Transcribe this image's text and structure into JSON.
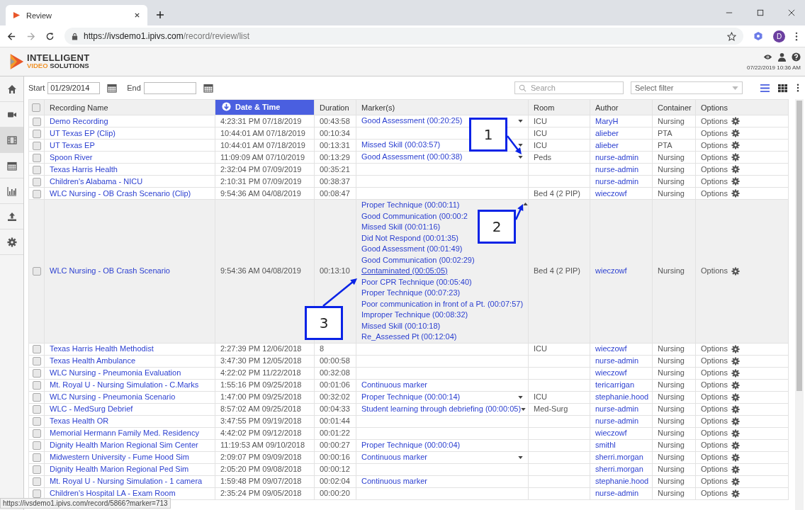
{
  "browser": {
    "tab_title": "Review",
    "url_host": "https://ivsdemo1.ipivs.com",
    "url_path": "/record/review/list",
    "profile_initial": "D"
  },
  "app": {
    "brand_line1": "INTELLIGENT",
    "brand_accent": "VIDEO",
    "brand_rest": "SOLUTIONS",
    "datetime": "07/22/2019 10:36 AM"
  },
  "sidebar": {
    "items": [
      {
        "kind": "home",
        "selected": false
      },
      {
        "kind": "camera",
        "selected": false
      },
      {
        "kind": "film",
        "selected": true
      },
      {
        "kind": "calendar",
        "selected": false
      },
      {
        "kind": "chart",
        "selected": false
      },
      {
        "kind": "upload",
        "selected": false
      },
      {
        "kind": "settings",
        "selected": false
      }
    ]
  },
  "filters": {
    "start_label": "Start",
    "start_value": "01/29/2014",
    "end_label": "End"
  },
  "search": {
    "placeholder": "Search"
  },
  "filter_select": {
    "placeholder": "Select filter"
  },
  "view_modes": [
    {
      "kind": "list",
      "selected": true
    },
    {
      "kind": "grid",
      "selected": false
    }
  ],
  "table": {
    "select_all_checked": false,
    "columns": [
      {
        "label": "Recording Name",
        "selected": false
      },
      {
        "label": "Date & Time",
        "selected": true
      },
      {
        "label": "Duration",
        "selected": false
      },
      {
        "label": "Marker(s)",
        "selected": false
      },
      {
        "label": "Room",
        "selected": false
      },
      {
        "label": "Author",
        "selected": false
      },
      {
        "label": "Container",
        "selected": false
      },
      {
        "label": "Options",
        "selected": false
      }
    ],
    "rows": [
      {
        "checked": false,
        "hovered": false,
        "name": "Demo Recording",
        "date_time": "4:23:31 PM 07/18/2019",
        "duration": "00:43:58",
        "markers": [
          {
            "label": "Good Assessment (00:20:25)",
            "hovered": false
          }
        ],
        "marker_dropdown": {
          "expanded": false
        },
        "room": "ICU",
        "author": "MaryH",
        "container": "Nursing",
        "options": "Options"
      },
      {
        "checked": false,
        "hovered": false,
        "name": "UT Texas EP (Clip)",
        "date_time": "10:44:01 AM 07/18/2019",
        "duration": "00:10:34",
        "markers": [],
        "room": "ICU",
        "author": "alieber",
        "container": "PTA",
        "options": "Options"
      },
      {
        "checked": false,
        "hovered": false,
        "name": "UT Texas EP",
        "date_time": "10:44:01 AM 07/18/2019",
        "duration": "00:13:31",
        "markers": [
          {
            "label": "Missed Skill (00:03:57)",
            "hovered": false
          }
        ],
        "marker_dropdown": {
          "expanded": false
        },
        "room": "ICU",
        "author": "alieber",
        "container": "PTA",
        "options": "Options"
      },
      {
        "checked": false,
        "hovered": false,
        "name": "Spoon River",
        "date_time": "11:09:09 AM 07/10/2019",
        "duration": "00:13:29",
        "markers": [
          {
            "label": "Good Assessment (00:00:38)",
            "hovered": false
          }
        ],
        "marker_dropdown": {
          "expanded": false
        },
        "room": "Peds",
        "author": "nurse-admin",
        "container": "Nursing",
        "options": "Options"
      },
      {
        "checked": false,
        "hovered": false,
        "name": "Texas Harris Health",
        "date_time": "2:32:04 PM 07/09/2019",
        "duration": "00:35:21",
        "markers": [],
        "author": "nurse-admin",
        "container": "Nursing",
        "options": "Options"
      },
      {
        "checked": false,
        "hovered": false,
        "name": "Children's Alabama - NICU",
        "date_time": "2:10:31 PM 07/09/2019",
        "duration": "00:38:37",
        "markers": [],
        "author": "nurse-admin",
        "container": "Nursing",
        "options": "Options"
      },
      {
        "checked": false,
        "hovered": false,
        "name": "WLC Nursing - OB Crash Scenario (Clip)",
        "date_time": "9:54:36 AM 04/08/2019",
        "duration": "00:08:47",
        "markers": [],
        "room": "Bed 4 (2 PIP)",
        "author": "wieczowf",
        "container": "Nursing",
        "options": "Options"
      },
      {
        "checked": false,
        "hovered": true,
        "name": "WLC Nursing - OB Crash Scenario",
        "date_time": "9:54:36 AM 04/08/2019",
        "duration": "00:13:10",
        "markers": [
          {
            "label": "Proper Technique (00:00:11)",
            "hovered": false
          },
          {
            "label": "Good Communication (00:00:2",
            "hovered": false
          },
          {
            "label": "Missed Skill (00:01:16)",
            "hovered": false
          },
          {
            "label": "Did Not Respond (00:01:35)",
            "hovered": false
          },
          {
            "label": "Good Assessment (00:01:49)",
            "hovered": false
          },
          {
            "label": "Good Communication (00:02:29)",
            "hovered": false
          },
          {
            "label": "Contaminated (00:05:05)",
            "hovered": true
          },
          {
            "label": "Poor CPR Technique (00:05:40)",
            "hovered": false
          },
          {
            "label": "Proper Technique (00:07:23)",
            "hovered": false
          },
          {
            "label": "Poor communication in front of a Pt. (00:07:57)",
            "hovered": false
          },
          {
            "label": "Improper Technique (00:08:32)",
            "hovered": false
          },
          {
            "label": "Missed Skill (00:10:18)",
            "hovered": false
          },
          {
            "label": "Re_Assessed Pt (00:12:04)",
            "hovered": false
          }
        ],
        "marker_dropdown": {
          "expanded": true
        },
        "room": "Bed 4 (2 PIP)",
        "author": "wieczowf",
        "container": "Nursing",
        "options": "Options"
      },
      {
        "checked": false,
        "hovered": false,
        "name": "Texas Harris Health Methodist",
        "date_time": "2:27:39 PM 12/06/2018",
        "duration": "8",
        "markers": [],
        "room": "ICU",
        "author": "wieczowf",
        "container": "Nursing",
        "options": "Options"
      },
      {
        "checked": false,
        "hovered": false,
        "name": "Texas Health Ambulance",
        "date_time": "3:47:30 PM 12/05/2018",
        "duration": "00:00:58",
        "markers": [],
        "author": "nurse-admin",
        "container": "Nursing",
        "options": "Options"
      },
      {
        "checked": false,
        "hovered": false,
        "name": "WLC Nursing - Pneumonia Evaluation",
        "date_time": "4:22:02 PM 11/22/2018",
        "duration": "00:32:08",
        "markers": [],
        "author": "wieczowf",
        "container": "Nursing",
        "options": "Options"
      },
      {
        "checked": false,
        "hovered": false,
        "name": "Mt. Royal U - Nursing Simulation - C.Marks",
        "date_time": "1:55:16 PM 09/25/2018",
        "duration": "00:01:06",
        "markers": [
          {
            "label": "Continuous marker",
            "hovered": false
          }
        ],
        "author": "tericarrigan",
        "container": "Nursing",
        "options": "Options"
      },
      {
        "checked": false,
        "hovered": false,
        "name": "WLC Nursing - Pneumonia Scenario",
        "date_time": "1:47:00 PM 09/25/2018",
        "duration": "00:32:02",
        "markers": [
          {
            "label": "Proper Technique (00:00:14)",
            "hovered": false
          }
        ],
        "marker_dropdown": {
          "expanded": false
        },
        "room": "ICU",
        "author": "stephanie.hood",
        "container": "Nursing",
        "options": "Options"
      },
      {
        "checked": false,
        "hovered": false,
        "name": "WLC - MedSurg Debrief",
        "date_time": "8:57:02 AM 09/25/2018",
        "duration": "00:04:33",
        "markers": [
          {
            "label": "Student learning through debriefing (00:00:05)",
            "hovered": false
          }
        ],
        "marker_dropdown": {
          "expanded": false
        },
        "room": "Med-Surg",
        "author": "nurse-admin",
        "container": "Nursing",
        "options": "Options"
      },
      {
        "checked": false,
        "hovered": false,
        "name": "Texas Health OR",
        "date_time": "3:47:55 PM 09/19/2018",
        "duration": "00:01:44",
        "markers": [],
        "author": "nurse-admin",
        "container": "Nursing",
        "options": "Options"
      },
      {
        "checked": false,
        "hovered": false,
        "name": "Memorial Hermann Family Med. Residency",
        "date_time": "4:42:02 PM 09/12/2018",
        "duration": "00:01:22",
        "markers": [],
        "author": "wieczowf",
        "container": "Nursing",
        "options": "Options"
      },
      {
        "checked": false,
        "hovered": false,
        "name": "Dignity Health Marion Regional Sim Center",
        "date_time": "11:19:53 AM 09/10/2018",
        "duration": "00:00:27",
        "markers": [
          {
            "label": "Proper Technique (00:00:04)",
            "hovered": false
          }
        ],
        "author": "smithl",
        "container": "Nursing",
        "options": "Options"
      },
      {
        "checked": false,
        "hovered": false,
        "name": "Midwestern University - Fume Hood Sim",
        "date_time": "2:09:07 PM 09/09/2018",
        "duration": "00:00:16",
        "markers": [
          {
            "label": "Continuous marker",
            "hovered": false
          }
        ],
        "marker_dropdown": {
          "expanded": false
        },
        "author": "sherri.morgan",
        "container": "Nursing",
        "options": "Options"
      },
      {
        "checked": false,
        "hovered": false,
        "name": "Dignity Health Marion Regional Ped Sim",
        "date_time": "2:05:20 PM 09/08/2018",
        "duration": "00:00:12",
        "markers": [],
        "author": "sherri.morgan",
        "container": "Nursing",
        "options": "Options"
      },
      {
        "checked": false,
        "hovered": false,
        "name": "Mt. Royal U - Nursing Simulation - 1 camera",
        "date_time": "1:59:48 PM 09/07/2018",
        "duration": "00:02:04",
        "markers": [
          {
            "label": "Continuous marker",
            "hovered": false
          }
        ],
        "author": "stephanie.hood",
        "container": "Nursing",
        "options": "Options"
      },
      {
        "checked": false,
        "hovered": false,
        "name": "Children's Hospital LA - Exam Room",
        "date_time": "2:35:24 PM 09/05/2018",
        "duration": "00:00:20",
        "markers": [],
        "author": "nurse-admin",
        "container": "Nursing",
        "options": "Options"
      }
    ]
  },
  "status_url": "https://ivsdemo1.ipivs.com/record/5866?marker=713",
  "callouts": [
    {
      "label": "1"
    },
    {
      "label": "2"
    },
    {
      "label": "3"
    }
  ]
}
